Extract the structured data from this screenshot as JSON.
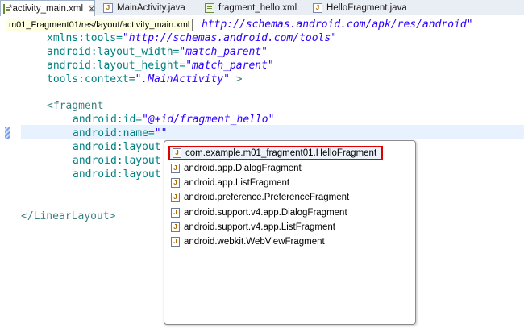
{
  "tabs": [
    {
      "label": "*activity_main.xml",
      "icon": "xml-file-icon",
      "active": true,
      "close": "⊠"
    },
    {
      "label": "MainActivity.java",
      "icon": "java-file-icon",
      "active": false
    },
    {
      "label": "fragment_hello.xml",
      "icon": "xml-file-icon",
      "active": false
    },
    {
      "label": "HelloFragment.java",
      "icon": "java-file-icon",
      "active": false
    }
  ],
  "tooltip": "m01_Fragment01/res/layout/activity_main.xml",
  "code": {
    "line1_value": "http://schemas.android.com/apk/res/android\"",
    "line2_attr": "xmlns:tools=",
    "line2_value": "\"http://schemas.android.com/tools\"",
    "line3_attr": "android:layout_width=",
    "line3_value": "\"match_parent\"",
    "line4_attr": "android:layout_height=",
    "line4_value": "\"match_parent\"",
    "line5_attr": "tools:context=",
    "line5_value": "\".MainActivity\"",
    "line5_end": " >",
    "line7_tag": "<fragment",
    "line8_attr": "android:id=",
    "line8_value": "\"@+id/fragment_hello\"",
    "line9_attr": "android:name=",
    "line9_value": "\"\"",
    "line10_attr": "android:layout",
    "line11_attr": "android:layout",
    "line12_attr": "android:layout",
    "line15_tag": "</LinearLayout>"
  },
  "completion": {
    "items": [
      {
        "label": "com.example.m01_fragment01.HelloFragment",
        "icon": "java-class-icon",
        "selected": true
      },
      {
        "label": "android.app.DialogFragment",
        "icon": "java-class-icon"
      },
      {
        "label": "android.app.ListFragment",
        "icon": "java-class-icon"
      },
      {
        "label": "android.preference.PreferenceFragment",
        "icon": "java-class-icon"
      },
      {
        "label": "android.support.v4.app.DialogFragment",
        "icon": "java-class-icon"
      },
      {
        "label": "android.support.v4.app.ListFragment",
        "icon": "java-class-icon"
      },
      {
        "label": "android.webkit.WebViewFragment",
        "icon": "java-class-icon"
      }
    ]
  },
  "colors": {
    "highlight_border": "#e00000",
    "attr": "#008080",
    "value": "#2a00ff",
    "tag": "#3f7f7f"
  }
}
